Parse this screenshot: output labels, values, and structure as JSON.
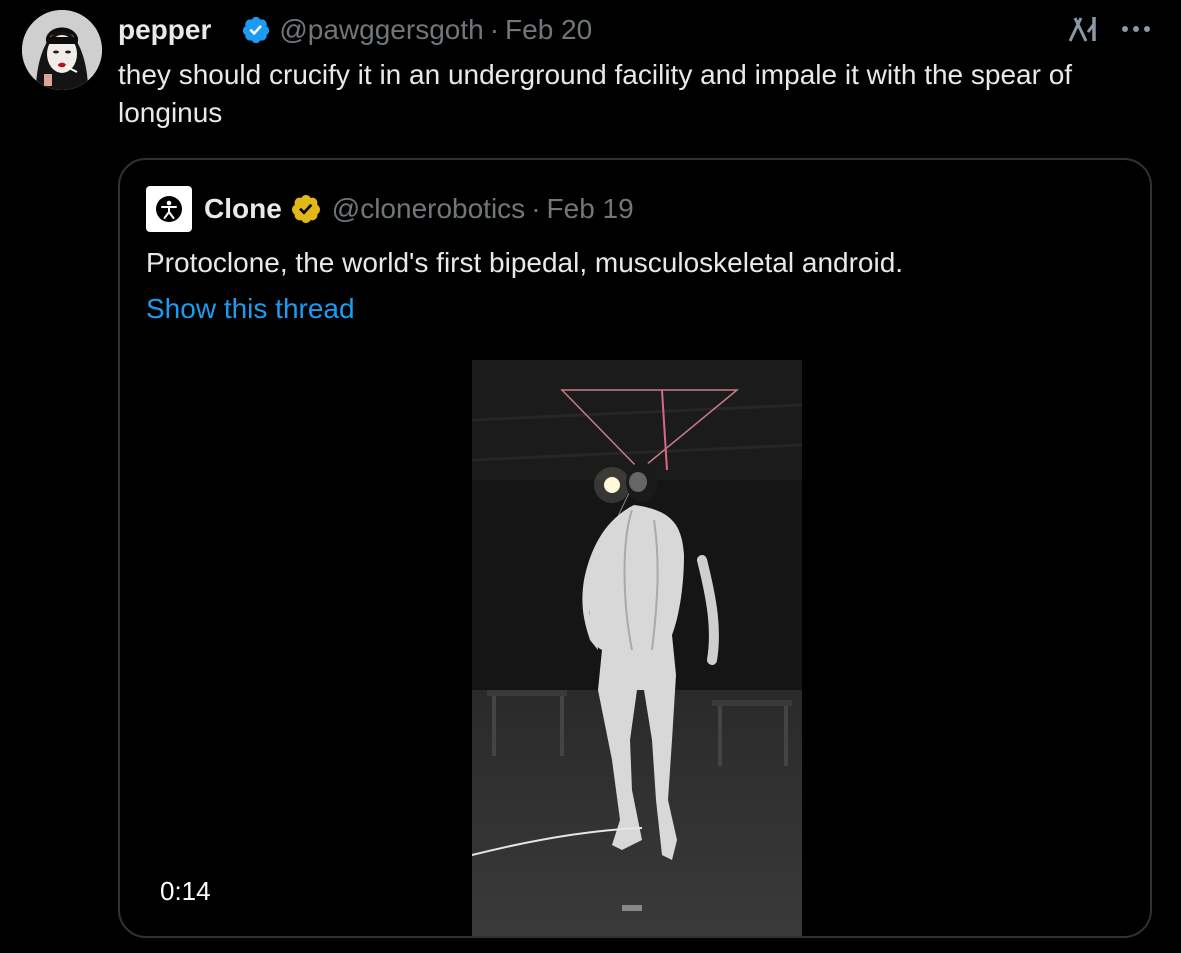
{
  "tweet": {
    "display_name": "pepper",
    "handle": "@pawggersgoth",
    "separator": "·",
    "date": "Feb 20",
    "text": "they should crucify it in an underground facility and impale it with the spear of longinus"
  },
  "quoted": {
    "display_name": "Clone",
    "handle": "@clonerobotics",
    "separator": "·",
    "date": "Feb 19",
    "text": "Protoclone, the world's first bipedal, musculoskeletal android.",
    "thread_link": "Show this thread",
    "video_duration": "0:14"
  },
  "icons": {
    "verified_blue": "verified-badge-blue",
    "verified_gold": "verified-badge-gold",
    "grok": "grok-icon",
    "more": "more-icon"
  },
  "colors": {
    "background": "#000000",
    "text": "#e7e9ea",
    "muted": "#71767b",
    "link": "#1d9bf0",
    "border": "#2f3336",
    "verified_blue": "#1d9bf0",
    "verified_gold": "#e2b719"
  }
}
